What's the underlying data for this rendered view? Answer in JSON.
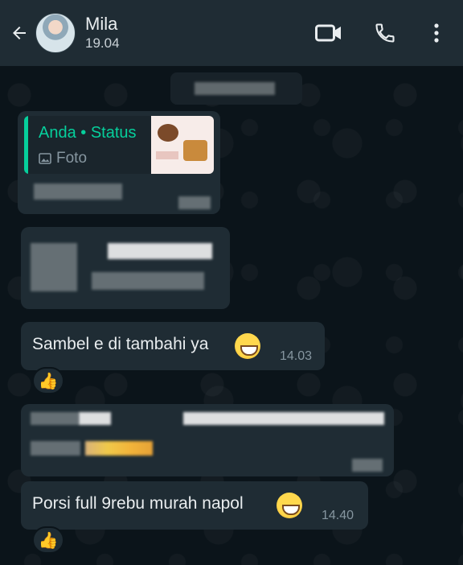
{
  "header": {
    "contact_name": "Mila",
    "status": "19.04"
  },
  "quoted": {
    "title": "Anda • Status",
    "subtitle": "Foto"
  },
  "messages": [
    {
      "text": "Sambel e di tambahi ya",
      "emoji": "grinning-face",
      "time": "14.03",
      "reaction": "👍"
    },
    {
      "text": "Porsi full 9rebu murah napol",
      "emoji": "grinning-face",
      "time": "14.40",
      "reaction": "👍"
    }
  ],
  "colors": {
    "background": "#0b141a",
    "header": "#1f2c34",
    "bubble": "#1f2c34",
    "accent": "#06cf9c",
    "meta_text": "#8696a0"
  }
}
